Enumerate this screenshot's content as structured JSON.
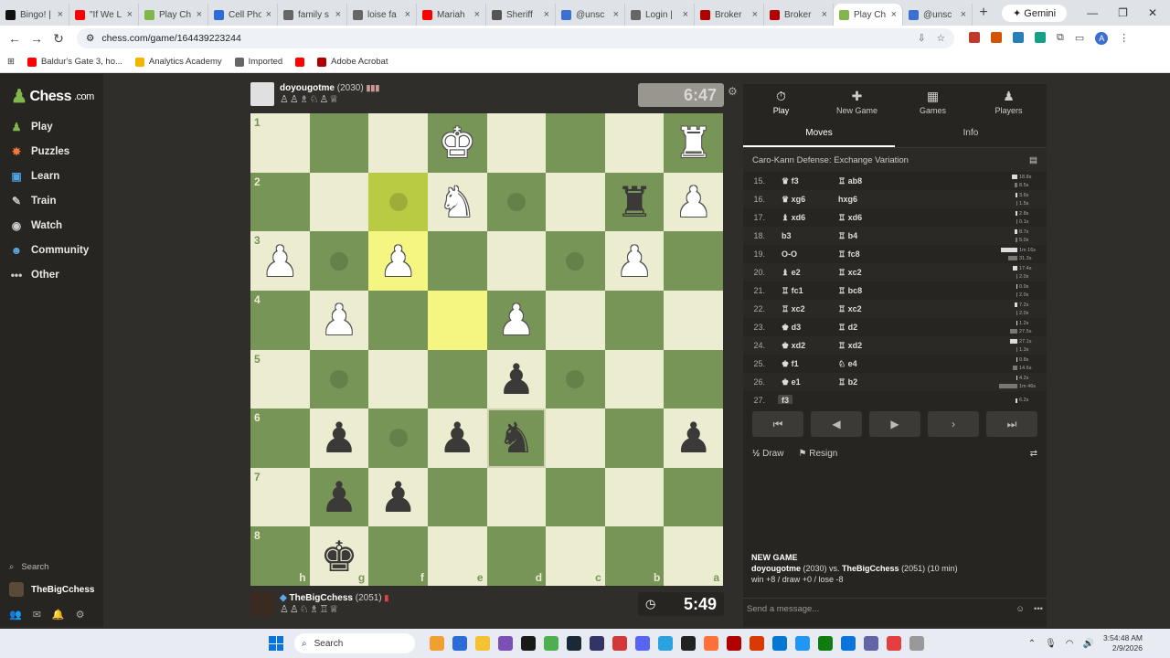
{
  "browser": {
    "tabs": [
      {
        "label": "Bingo! |",
        "color": "#111111",
        "active": false
      },
      {
        "label": "\"If We L",
        "color": "#ff0000",
        "active": false
      },
      {
        "label": "Play Ch",
        "color": "#81b64c",
        "active": false
      },
      {
        "label": "Cell Pho",
        "color": "#2b6cd8",
        "active": false
      },
      {
        "label": "family s",
        "color": "#666666",
        "active": false
      },
      {
        "label": "loise fa",
        "color": "#666666",
        "active": false
      },
      {
        "label": "Mariah",
        "color": "#ff0000",
        "active": false
      },
      {
        "label": "Sheriff",
        "color": "#555555",
        "active": false
      },
      {
        "label": "@unsc",
        "color": "#3b6fd0",
        "active": false
      },
      {
        "label": "Login |",
        "color": "#666666",
        "active": false
      },
      {
        "label": "Broker",
        "color": "#b00000",
        "active": false
      },
      {
        "label": "Broker",
        "color": "#b00000",
        "active": false
      },
      {
        "label": "Play Ch",
        "color": "#81b64c",
        "active": true
      },
      {
        "label": "@unsc",
        "color": "#3b6fd0",
        "active": false
      }
    ],
    "gemini_label": "Gemini",
    "url": "chess.com/game/164439223244",
    "bookmarks": [
      {
        "label": "Baldur's Gate 3, ho...",
        "color": "#ff0000"
      },
      {
        "label": "Analytics Academy",
        "color": "#f4b400"
      },
      {
        "label": "Imported",
        "color": "#666666"
      },
      {
        "label": "",
        "color": "#ff0000"
      },
      {
        "label": "Adobe Acrobat",
        "color": "#b00000"
      }
    ]
  },
  "sidebar": {
    "logo": "Chess",
    "logo_suffix": ".com",
    "items": [
      {
        "label": "Play",
        "icon": "pawn-icon",
        "glyph": "♟",
        "color": "#81b64c"
      },
      {
        "label": "Puzzles",
        "icon": "puzzle-icon",
        "glyph": "✸",
        "color": "#f07a3a"
      },
      {
        "label": "Learn",
        "icon": "learn-icon",
        "glyph": "▣",
        "color": "#4ba3e3"
      },
      {
        "label": "Train",
        "icon": "train-icon",
        "glyph": "✎",
        "color": "#cccccc"
      },
      {
        "label": "Watch",
        "icon": "watch-icon",
        "glyph": "◉",
        "color": "#cccccc"
      },
      {
        "label": "Community",
        "icon": "community-icon",
        "glyph": "☻",
        "color": "#5fa8e8"
      },
      {
        "label": "Other",
        "icon": "more-icon",
        "glyph": "•••",
        "color": "#cccccc"
      }
    ],
    "search_label": "Search",
    "username": "TheBigCchess"
  },
  "game": {
    "top_player": {
      "name": "doyougotme",
      "rating": "(2030)",
      "captured": "♙♙♗♘♙♕",
      "clock": "6:47"
    },
    "bottom_player": {
      "name": "TheBigCchess",
      "rating": "(2051)",
      "captured": "♙♙♘♗♖♕",
      "clock": "5:49"
    },
    "board": [
      [
        "",
        "",
        "",
        "wK",
        "",
        "",
        "",
        "wR"
      ],
      [
        "",
        "",
        "",
        "wN",
        "",
        "",
        "bR",
        "wP"
      ],
      [
        "wP",
        "",
        "wP",
        "",
        "",
        "",
        "wP",
        ""
      ],
      [
        "",
        "wP",
        "",
        "",
        "wP",
        "",
        "",
        ""
      ],
      [
        "",
        "",
        "",
        "",
        "bP",
        "",
        "",
        ""
      ],
      [
        "",
        "bP",
        "",
        "bP",
        "bN",
        "",
        "",
        "bP"
      ],
      [
        "",
        "bP",
        "bP",
        "",
        "",
        "",
        "",
        ""
      ],
      [
        "",
        "bK",
        "",
        "",
        "",
        "",
        "",
        ""
      ]
    ],
    "ranks": [
      "1",
      "2",
      "3",
      "4",
      "5",
      "6",
      "7",
      "8"
    ],
    "files": [
      "h",
      "g",
      "f",
      "e",
      "d",
      "c",
      "b",
      "a"
    ],
    "highlight_squares": [
      "1-2",
      "2-2",
      "3-3"
    ],
    "hint_squares": [
      "1-2",
      "1-4",
      "2-1",
      "2-5",
      "4-1",
      "4-5",
      "5-2"
    ],
    "selected_square": "5-4"
  },
  "panel": {
    "tabs": [
      {
        "label": "Play",
        "glyph": "⏱",
        "icon": "stopwatch-icon",
        "active": true
      },
      {
        "label": "New Game",
        "glyph": "✚",
        "icon": "new-game-icon",
        "active": false
      },
      {
        "label": "Games",
        "glyph": "▦",
        "icon": "games-icon",
        "active": false
      },
      {
        "label": "Players",
        "glyph": "♟",
        "icon": "players-icon",
        "active": false
      }
    ],
    "subtabs": [
      {
        "label": "Moves",
        "active": true
      },
      {
        "label": "Info",
        "active": false
      }
    ],
    "opening": "Caro-Kann Defense: Exchange Variation",
    "moves": [
      {
        "n": "15.",
        "w": "♛ f3",
        "b": "♖ ab8",
        "tw": "18.8s",
        "tb": "8.5s",
        "ww": 6,
        "bw": 3
      },
      {
        "n": "16.",
        "w": "♛ xg6",
        "b": "hxg6",
        "tw": "3.6s",
        "tb": "1.5s",
        "ww": 2,
        "bw": 1
      },
      {
        "n": "17.",
        "w": "♝ xd6",
        "b": "♖ xd6",
        "tw": "2.8s",
        "tb": "0.1s",
        "ww": 2,
        "bw": 1
      },
      {
        "n": "18.",
        "w": "b3",
        "b": "♖ b4",
        "tw": "8.7s",
        "tb": "5.0s",
        "ww": 3,
        "bw": 2
      },
      {
        "n": "19.",
        "w": "O-O",
        "b": "♖ fc8",
        "tw": "1m 16s",
        "tb": "31.3s",
        "ww": 18,
        "bw": 10
      },
      {
        "n": "20.",
        "w": "♝ e2",
        "b": "♖ xc2",
        "tw": "17.4s",
        "tb": "2.0s",
        "ww": 5,
        "bw": 1
      },
      {
        "n": "21.",
        "w": "♖ fc1",
        "b": "♖ bc8",
        "tw": "0.9s",
        "tb": "2.0s",
        "ww": 1,
        "bw": 1
      },
      {
        "n": "22.",
        "w": "♖ xc2",
        "b": "♖ xc2",
        "tw": "7.2s",
        "tb": "2.0s",
        "ww": 3,
        "bw": 1
      },
      {
        "n": "23.",
        "w": "♚ d3",
        "b": "♖ d2",
        "tw": "1.2s",
        "tb": "27.5s",
        "ww": 1,
        "bw": 8
      },
      {
        "n": "24.",
        "w": "♚ xd2",
        "b": "♖ xd2",
        "tw": "27.1s",
        "tb": "1.3s",
        "ww": 8,
        "bw": 1
      },
      {
        "n": "25.",
        "w": "♚ f1",
        "b": "♘ e4",
        "tw": "0.8s",
        "tb": "14.6s",
        "ww": 1,
        "bw": 5
      },
      {
        "n": "26.",
        "w": "♚ e1",
        "b": "♖ b2",
        "tw": "4.2s",
        "tb": "1m 46s",
        "ww": 1,
        "bw": 20
      },
      {
        "n": "27.",
        "w": "f3",
        "b": "",
        "tw": "6.2s",
        "tb": "",
        "ww": 2,
        "bw": 0
      }
    ],
    "draw_label": "Draw",
    "draw_glyph": "½",
    "resign_label": "Resign",
    "new_game_heading": "NEW GAME",
    "new_game_line1_a": "doyougotme",
    "new_game_line1_b": " (2030) vs. ",
    "new_game_line1_c": "TheBigCchess",
    "new_game_line1_d": " (2051) (10 min)",
    "new_game_line2": "win +8 / draw +0 / lose -8",
    "message_placeholder": "Send a message..."
  },
  "taskbar": {
    "search_label": "Search",
    "time": "3:54:48 AM",
    "date": "2/9/2026",
    "apps": [
      "#f0a030",
      "#2b6cd8",
      "#f4c430",
      "#7b4fb5",
      "#1a1a1a",
      "#4caf50",
      "#1b2838",
      "#333366",
      "#d23a3a",
      "#5865f2",
      "#2aa3e0",
      "#222222",
      "#ff7139",
      "#b00000",
      "#d83b01",
      "#0078d4",
      "#2196f3",
      "#107c10",
      "#0a74da",
      "#6264a7",
      "#e04040",
      "#999999"
    ]
  }
}
